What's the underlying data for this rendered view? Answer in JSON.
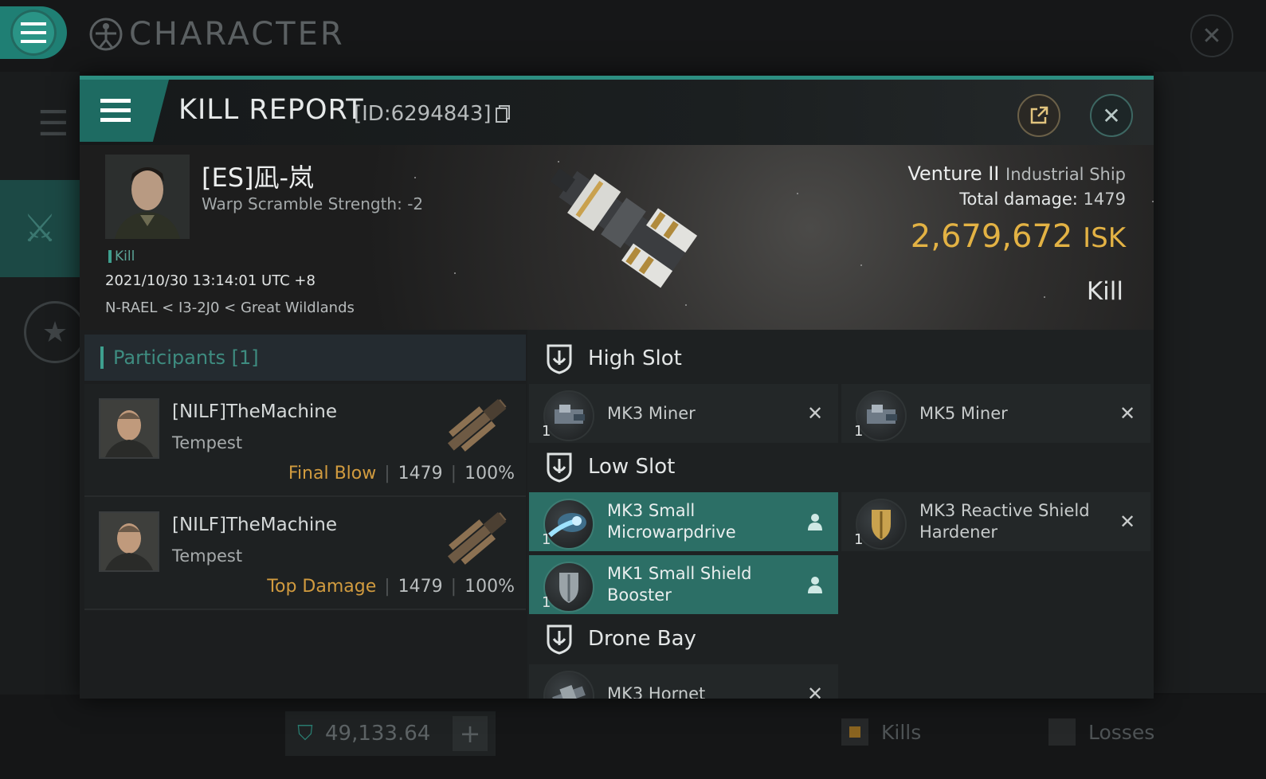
{
  "background": {
    "title": "CHARACTER",
    "isk_balance": "49,133.64",
    "add_label": "+",
    "filters": {
      "kills_label": "Kills",
      "losses_label": "Losses"
    }
  },
  "report": {
    "title": "KILL REPORT",
    "id_text": "[ID:6294843]",
    "victim": {
      "name": "[ES]凪-岚",
      "warp_scramble": "Warp Scramble Strength: -2",
      "tag": "Kill",
      "time": "2021/10/30 13:14:01 UTC +8",
      "location": "N-RAEL < I3-2J0 < Great Wildlands"
    },
    "ship": {
      "name": "Venture II",
      "class": "Industrial Ship",
      "total_damage_label": "Total damage:",
      "total_damage": "1479",
      "isk_value": "2,679,672",
      "isk_unit": "ISK",
      "result": "Kill"
    }
  },
  "participants": {
    "header": "Participants [1]",
    "items": [
      {
        "name": "[NILF]TheMachine",
        "ship": "Tempest",
        "role": "Final Blow",
        "damage": "1479",
        "percent": "100%"
      },
      {
        "name": "[NILF]TheMachine",
        "ship": "Tempest",
        "role": "Top Damage",
        "damage": "1479",
        "percent": "100%"
      }
    ]
  },
  "fittings": {
    "high": {
      "label": "High Slot",
      "modules": [
        {
          "name": "MK3 Miner",
          "qty": "1",
          "state": "destroyed"
        },
        {
          "name": "MK5 Miner",
          "qty": "1",
          "state": "destroyed"
        }
      ]
    },
    "low": {
      "label": "Low Slot",
      "modules": [
        {
          "name": "MK3 Small Microwarpdrive",
          "qty": "1",
          "state": "dropped"
        },
        {
          "name": "MK3 Reactive Shield Hardener",
          "qty": "1",
          "state": "destroyed"
        },
        {
          "name": "MK1 Small Shield Booster",
          "qty": "1",
          "state": "dropped"
        }
      ]
    },
    "drone": {
      "label": "Drone Bay",
      "modules": [
        {
          "name": "MK3 Hornet",
          "qty": "",
          "state": "destroyed"
        }
      ]
    }
  },
  "colors": {
    "accent": "#2c8e81",
    "isk": "#e3b244",
    "role": "#d19b3f"
  }
}
